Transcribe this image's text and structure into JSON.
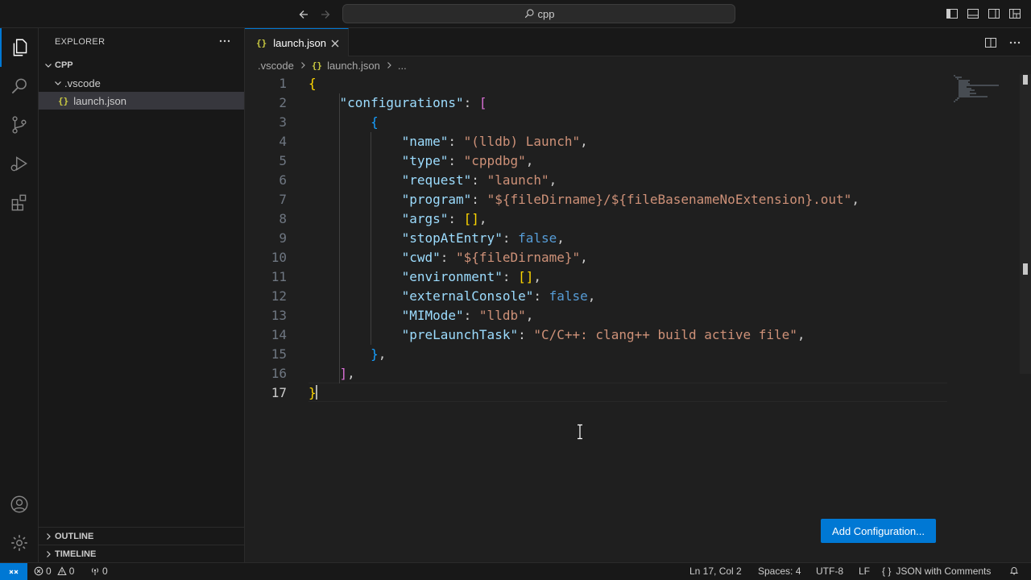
{
  "titlebar": {
    "search_text": "cpp"
  },
  "sidebar": {
    "header": "EXPLORER",
    "root_folder": "CPP",
    "folder": ".vscode",
    "file": "launch.json",
    "file_icon": "{}",
    "outline": "OUTLINE",
    "timeline": "TIMELINE"
  },
  "editor": {
    "tab_label": "launch.json",
    "tab_icon": "{}",
    "breadcrumb": {
      "folder": ".vscode",
      "file_icon": "{}",
      "file": "launch.json",
      "more": "..."
    },
    "lines": [
      {
        "n": "1",
        "tokens": [
          [
            "y",
            "{"
          ]
        ]
      },
      {
        "n": "2",
        "tokens": [
          [
            "p",
            "    "
          ],
          [
            "k",
            "\"configurations\""
          ],
          [
            "p",
            ": "
          ],
          [
            "m",
            "["
          ]
        ]
      },
      {
        "n": "3",
        "tokens": [
          [
            "p",
            "        "
          ],
          [
            "c",
            "{"
          ]
        ]
      },
      {
        "n": "4",
        "tokens": [
          [
            "p",
            "            "
          ],
          [
            "k",
            "\"name\""
          ],
          [
            "p",
            ": "
          ],
          [
            "s",
            "\"(lldb) Launch\""
          ],
          [
            "p",
            ","
          ]
        ]
      },
      {
        "n": "5",
        "tokens": [
          [
            "p",
            "            "
          ],
          [
            "k",
            "\"type\""
          ],
          [
            "p",
            ": "
          ],
          [
            "s",
            "\"cppdbg\""
          ],
          [
            "p",
            ","
          ]
        ]
      },
      {
        "n": "6",
        "tokens": [
          [
            "p",
            "            "
          ],
          [
            "k",
            "\"request\""
          ],
          [
            "p",
            ": "
          ],
          [
            "s",
            "\"launch\""
          ],
          [
            "p",
            ","
          ]
        ]
      },
      {
        "n": "7",
        "tokens": [
          [
            "p",
            "            "
          ],
          [
            "k",
            "\"program\""
          ],
          [
            "p",
            ": "
          ],
          [
            "s",
            "\"${fileDirname}/${fileBasenameNoExtension}.out\""
          ],
          [
            "p",
            ","
          ]
        ]
      },
      {
        "n": "8",
        "tokens": [
          [
            "p",
            "            "
          ],
          [
            "k",
            "\"args\""
          ],
          [
            "p",
            ": "
          ],
          [
            "y",
            "[]"
          ],
          [
            "p",
            ","
          ]
        ]
      },
      {
        "n": "9",
        "tokens": [
          [
            "p",
            "            "
          ],
          [
            "k",
            "\"stopAtEntry\""
          ],
          [
            "p",
            ": "
          ],
          [
            "b",
            "false"
          ],
          [
            "p",
            ","
          ]
        ]
      },
      {
        "n": "10",
        "tokens": [
          [
            "p",
            "            "
          ],
          [
            "k",
            "\"cwd\""
          ],
          [
            "p",
            ": "
          ],
          [
            "s",
            "\"${fileDirname}\""
          ],
          [
            "p",
            ","
          ]
        ]
      },
      {
        "n": "11",
        "tokens": [
          [
            "p",
            "            "
          ],
          [
            "k",
            "\"environment\""
          ],
          [
            "p",
            ": "
          ],
          [
            "y",
            "[]"
          ],
          [
            "p",
            ","
          ]
        ]
      },
      {
        "n": "12",
        "tokens": [
          [
            "p",
            "            "
          ],
          [
            "k",
            "\"externalConsole\""
          ],
          [
            "p",
            ": "
          ],
          [
            "b",
            "false"
          ],
          [
            "p",
            ","
          ]
        ]
      },
      {
        "n": "13",
        "tokens": [
          [
            "p",
            "            "
          ],
          [
            "k",
            "\"MIMode\""
          ],
          [
            "p",
            ": "
          ],
          [
            "s",
            "\"lldb\""
          ],
          [
            "p",
            ","
          ]
        ]
      },
      {
        "n": "14",
        "tokens": [
          [
            "p",
            "            "
          ],
          [
            "k",
            "\"preLaunchTask\""
          ],
          [
            "p",
            ": "
          ],
          [
            "s",
            "\"C/C++: clang++ build active file\""
          ],
          [
            "p",
            ","
          ]
        ]
      },
      {
        "n": "15",
        "tokens": [
          [
            "p",
            "        "
          ],
          [
            "c",
            "}"
          ],
          [
            "p",
            ","
          ]
        ]
      },
      {
        "n": "16",
        "tokens": [
          [
            "p",
            "    "
          ],
          [
            "m",
            "]"
          ],
          [
            "p",
            ","
          ]
        ]
      },
      {
        "n": "17",
        "tokens": [
          [
            "y",
            "}"
          ]
        ]
      }
    ],
    "add_configuration": "Add Configuration..."
  },
  "statusbar": {
    "errors": "0",
    "warnings": "0",
    "ports": "0",
    "cursor_position": "Ln 17, Col 2",
    "indentation": "Spaces: 4",
    "encoding": "UTF-8",
    "eol": "LF",
    "language_icon": "{ }",
    "language": "JSON with Comments"
  },
  "colors": {
    "accent": "#0078d4",
    "background": "#1f1f1f",
    "sidebar": "#181818"
  }
}
